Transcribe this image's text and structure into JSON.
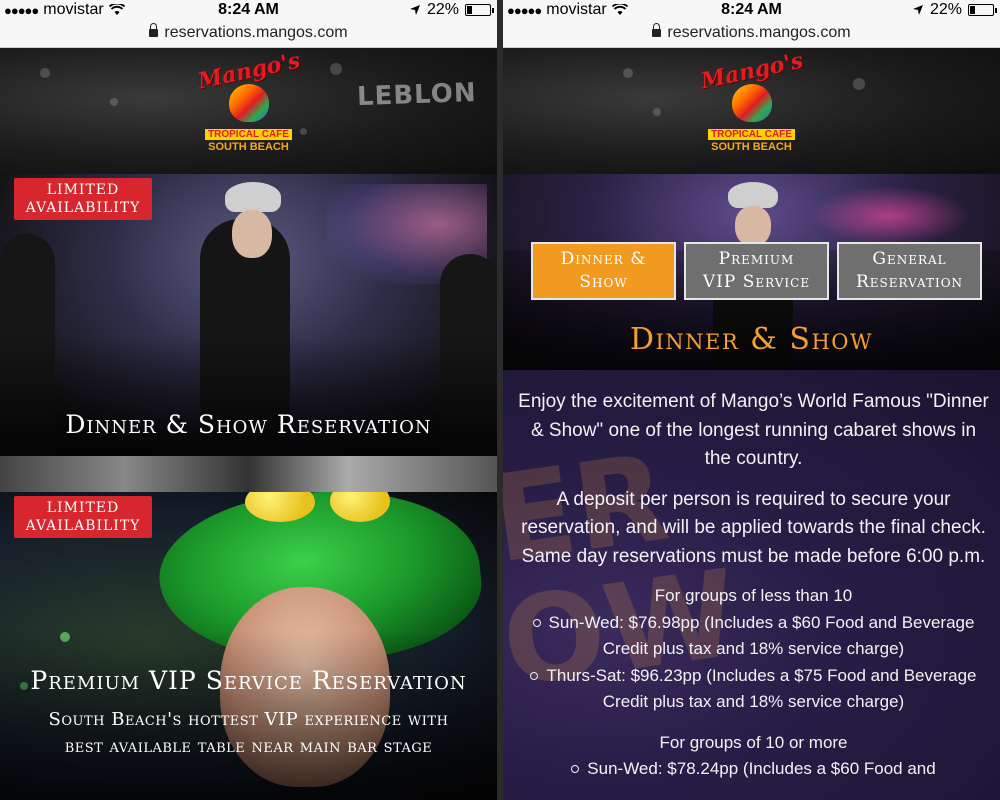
{
  "status_bar": {
    "carrier": "movistar",
    "time": "8:24 AM",
    "battery": "22%",
    "battery_level": 0.22
  },
  "browser": {
    "url": "reservations.mangos.com"
  },
  "logo": {
    "script_text": "Mango's",
    "tropical_cafe": "TROPICAL CAFE",
    "location": "SOUTH BEACH"
  },
  "header_sign": "LEBLON",
  "left_screen": {
    "cards": [
      {
        "badge": [
          "LIMITED",
          "AVAILABILITY"
        ],
        "title": "Dinner & Show Reservation",
        "subtitle": []
      },
      {
        "badge": [
          "LIMITED",
          "AVAILABILITY"
        ],
        "title": "Premium VIP Service Reservation",
        "subtitle": [
          "South Beach's hottest VIP experience with",
          "best available table near main bar stage"
        ]
      }
    ]
  },
  "right_screen": {
    "tabs": [
      {
        "lines": [
          "Dinner &",
          "Show"
        ],
        "active": true
      },
      {
        "lines": [
          "Premium",
          "VIP Service"
        ],
        "active": false
      },
      {
        "lines": [
          "General",
          "Reservation"
        ],
        "active": false
      }
    ],
    "section_title": "Dinner & Show",
    "paragraphs": [
      "Enjoy the excitement of Mango’s World Famous \"Dinner & Show\" one of the longest running cabaret shows in the country.",
      "A deposit per person is required to secure your reservation, and will be applied towards the final check. Same day reservations must be made before 6:00 p.m."
    ],
    "groups": [
      {
        "heading": "For groups of less than 10",
        "items": [
          "Sun-Wed: $76.98pp (Includes a $60 Food and Beverage Credit plus tax and 18% service charge)",
          "Thurs-Sat: $96.23pp (Includes a $75 Food and Beverage Credit plus tax and 18% service charge)"
        ]
      },
      {
        "heading": "For groups of 10 or more",
        "items": [
          "Sun-Wed: $78.24pp (Includes a $60 Food and"
        ]
      }
    ]
  },
  "colors": {
    "accent_orange": "#f29a1f",
    "badge_red": "#d7262d",
    "title_gold": "#f3a02f",
    "tab_gray": "#6f6f6f"
  }
}
